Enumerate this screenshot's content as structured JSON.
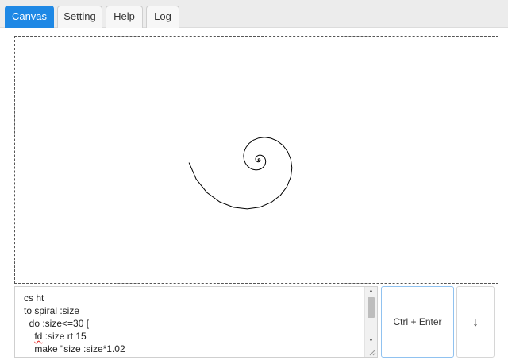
{
  "tabs": [
    {
      "label": "Canvas",
      "active": true
    },
    {
      "label": "Setting",
      "active": false
    },
    {
      "label": "Help",
      "active": false
    },
    {
      "label": "Log",
      "active": false
    }
  ],
  "canvas": {
    "drawing": "spiral",
    "stroke_color": "#000000",
    "background_color": "#ffffff"
  },
  "editor": {
    "lines": [
      "cs ht",
      "to spiral :size",
      "  do :size<=30 [",
      "    fd :size rt 15",
      "    make \"size :size*1.02"
    ],
    "scrollbar": {
      "up_icon": "triangle-up-icon",
      "down_icon": "triangle-down-icon"
    }
  },
  "buttons": {
    "run_label": "Ctrl + Enter",
    "down_label": "↓"
  },
  "colors": {
    "accent": "#1e88e5",
    "tabbar_bg": "#ececec",
    "run_border": "#90c2f0"
  }
}
